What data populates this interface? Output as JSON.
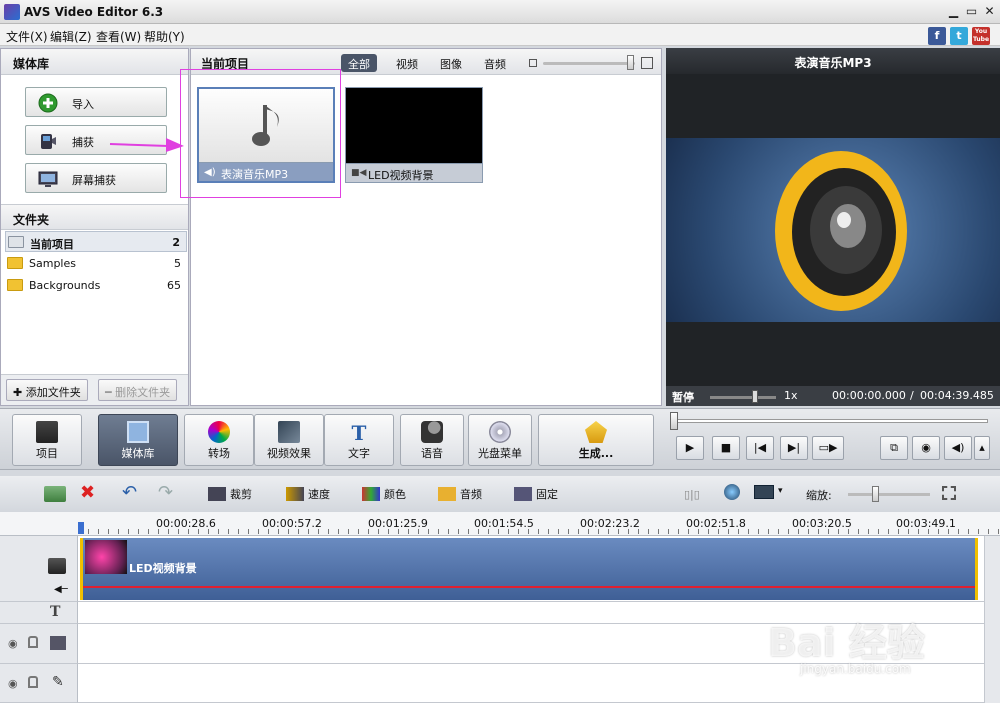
{
  "window": {
    "title": "AVS Video Editor 6.3"
  },
  "menu": [
    "文件(X)",
    "编辑(Z)",
    "查看(W)",
    "帮助(Y)"
  ],
  "social": [
    "f",
    "t",
    "You Tube"
  ],
  "left_panel": {
    "header": "媒体库",
    "buttons": [
      {
        "label": "导入",
        "icon": "import-icon"
      },
      {
        "label": "捕获",
        "icon": "camcorder-icon"
      },
      {
        "label": "屏幕捕获",
        "icon": "screen-capture-icon"
      }
    ],
    "folders_header": "文件夹",
    "folders": [
      {
        "name": "当前项目",
        "count": "2"
      },
      {
        "name": "Samples",
        "count": "5"
      },
      {
        "name": "Backgrounds",
        "count": "65"
      }
    ],
    "add_folder": "添加文件夹",
    "remove_folder": "删除文件夹"
  },
  "media_panel": {
    "header": "当前项目",
    "filters": [
      "全部",
      "视频",
      "图像",
      "音频"
    ],
    "items": [
      {
        "label": "表演音乐MP3",
        "type": "audio"
      },
      {
        "label": "LED视频背景",
        "type": "video"
      }
    ]
  },
  "preview": {
    "title": "表演音乐MP3",
    "state": "暂停",
    "speed": "1x",
    "time_current": "00:00:00.000",
    "time_separator": "/",
    "time_total": "00:04:39.485"
  },
  "toolbar": [
    "项目",
    "媒体库",
    "转场",
    "视频效果",
    "文字",
    "语音",
    "光盘菜单",
    "生成..."
  ],
  "timeline_tools": [
    "裁剪",
    "速度",
    "颜色",
    "音频",
    "固定"
  ],
  "zoom_label": "缩放:",
  "ruler": [
    "00:00:28.6",
    "00:00:57.2",
    "00:01:25.9",
    "00:01:54.5",
    "00:02:23.2",
    "00:02:51.8",
    "00:03:20.5",
    "00:03:49.1"
  ],
  "clip": {
    "label": "LED视频背景"
  },
  "watermark": {
    "brand": "Bai 经验",
    "url": "jingyan.baidu.com"
  },
  "colors": {
    "accent": "#4a5568",
    "clip": "#4f6fa6",
    "highlight": "#e040e0",
    "speaker_ring": "#f2b61a"
  }
}
